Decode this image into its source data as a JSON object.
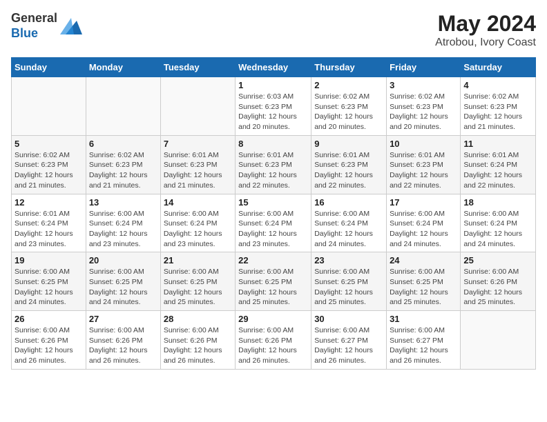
{
  "logo": {
    "general": "General",
    "blue": "Blue"
  },
  "title": {
    "month_year": "May 2024",
    "location": "Atrobou, Ivory Coast"
  },
  "weekdays": [
    "Sunday",
    "Monday",
    "Tuesday",
    "Wednesday",
    "Thursday",
    "Friday",
    "Saturday"
  ],
  "weeks": [
    [
      {
        "day": "",
        "info": ""
      },
      {
        "day": "",
        "info": ""
      },
      {
        "day": "",
        "info": ""
      },
      {
        "day": "1",
        "info": "Sunrise: 6:03 AM\nSunset: 6:23 PM\nDaylight: 12 hours\nand 20 minutes."
      },
      {
        "day": "2",
        "info": "Sunrise: 6:02 AM\nSunset: 6:23 PM\nDaylight: 12 hours\nand 20 minutes."
      },
      {
        "day": "3",
        "info": "Sunrise: 6:02 AM\nSunset: 6:23 PM\nDaylight: 12 hours\nand 20 minutes."
      },
      {
        "day": "4",
        "info": "Sunrise: 6:02 AM\nSunset: 6:23 PM\nDaylight: 12 hours\nand 21 minutes."
      }
    ],
    [
      {
        "day": "5",
        "info": "Sunrise: 6:02 AM\nSunset: 6:23 PM\nDaylight: 12 hours\nand 21 minutes."
      },
      {
        "day": "6",
        "info": "Sunrise: 6:02 AM\nSunset: 6:23 PM\nDaylight: 12 hours\nand 21 minutes."
      },
      {
        "day": "7",
        "info": "Sunrise: 6:01 AM\nSunset: 6:23 PM\nDaylight: 12 hours\nand 21 minutes."
      },
      {
        "day": "8",
        "info": "Sunrise: 6:01 AM\nSunset: 6:23 PM\nDaylight: 12 hours\nand 22 minutes."
      },
      {
        "day": "9",
        "info": "Sunrise: 6:01 AM\nSunset: 6:23 PM\nDaylight: 12 hours\nand 22 minutes."
      },
      {
        "day": "10",
        "info": "Sunrise: 6:01 AM\nSunset: 6:23 PM\nDaylight: 12 hours\nand 22 minutes."
      },
      {
        "day": "11",
        "info": "Sunrise: 6:01 AM\nSunset: 6:24 PM\nDaylight: 12 hours\nand 22 minutes."
      }
    ],
    [
      {
        "day": "12",
        "info": "Sunrise: 6:01 AM\nSunset: 6:24 PM\nDaylight: 12 hours\nand 23 minutes."
      },
      {
        "day": "13",
        "info": "Sunrise: 6:00 AM\nSunset: 6:24 PM\nDaylight: 12 hours\nand 23 minutes."
      },
      {
        "day": "14",
        "info": "Sunrise: 6:00 AM\nSunset: 6:24 PM\nDaylight: 12 hours\nand 23 minutes."
      },
      {
        "day": "15",
        "info": "Sunrise: 6:00 AM\nSunset: 6:24 PM\nDaylight: 12 hours\nand 23 minutes."
      },
      {
        "day": "16",
        "info": "Sunrise: 6:00 AM\nSunset: 6:24 PM\nDaylight: 12 hours\nand 24 minutes."
      },
      {
        "day": "17",
        "info": "Sunrise: 6:00 AM\nSunset: 6:24 PM\nDaylight: 12 hours\nand 24 minutes."
      },
      {
        "day": "18",
        "info": "Sunrise: 6:00 AM\nSunset: 6:24 PM\nDaylight: 12 hours\nand 24 minutes."
      }
    ],
    [
      {
        "day": "19",
        "info": "Sunrise: 6:00 AM\nSunset: 6:25 PM\nDaylight: 12 hours\nand 24 minutes."
      },
      {
        "day": "20",
        "info": "Sunrise: 6:00 AM\nSunset: 6:25 PM\nDaylight: 12 hours\nand 24 minutes."
      },
      {
        "day": "21",
        "info": "Sunrise: 6:00 AM\nSunset: 6:25 PM\nDaylight: 12 hours\nand 25 minutes."
      },
      {
        "day": "22",
        "info": "Sunrise: 6:00 AM\nSunset: 6:25 PM\nDaylight: 12 hours\nand 25 minutes."
      },
      {
        "day": "23",
        "info": "Sunrise: 6:00 AM\nSunset: 6:25 PM\nDaylight: 12 hours\nand 25 minutes."
      },
      {
        "day": "24",
        "info": "Sunrise: 6:00 AM\nSunset: 6:25 PM\nDaylight: 12 hours\nand 25 minutes."
      },
      {
        "day": "25",
        "info": "Sunrise: 6:00 AM\nSunset: 6:26 PM\nDaylight: 12 hours\nand 25 minutes."
      }
    ],
    [
      {
        "day": "26",
        "info": "Sunrise: 6:00 AM\nSunset: 6:26 PM\nDaylight: 12 hours\nand 26 minutes."
      },
      {
        "day": "27",
        "info": "Sunrise: 6:00 AM\nSunset: 6:26 PM\nDaylight: 12 hours\nand 26 minutes."
      },
      {
        "day": "28",
        "info": "Sunrise: 6:00 AM\nSunset: 6:26 PM\nDaylight: 12 hours\nand 26 minutes."
      },
      {
        "day": "29",
        "info": "Sunrise: 6:00 AM\nSunset: 6:26 PM\nDaylight: 12 hours\nand 26 minutes."
      },
      {
        "day": "30",
        "info": "Sunrise: 6:00 AM\nSunset: 6:27 PM\nDaylight: 12 hours\nand 26 minutes."
      },
      {
        "day": "31",
        "info": "Sunrise: 6:00 AM\nSunset: 6:27 PM\nDaylight: 12 hours\nand 26 minutes."
      },
      {
        "day": "",
        "info": ""
      }
    ]
  ]
}
